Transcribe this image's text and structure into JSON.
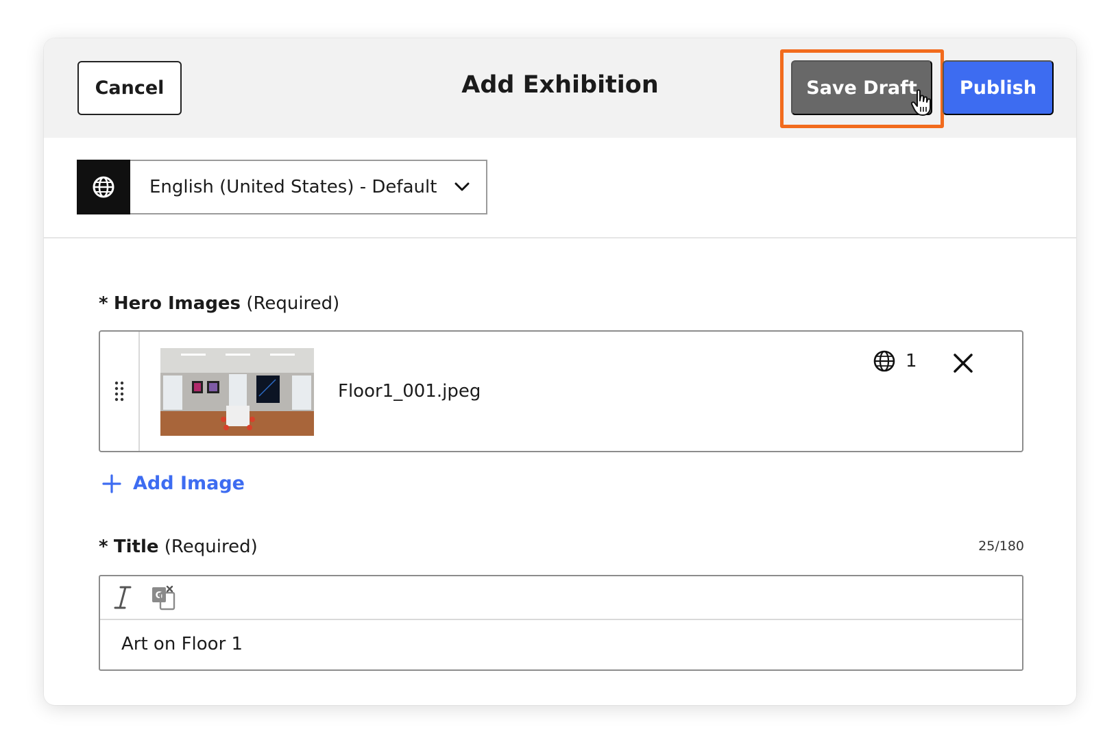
{
  "header": {
    "cancel_label": "Cancel",
    "title": "Add Exhibition",
    "save_draft_label": "Save Draft",
    "publish_label": "Publish"
  },
  "language": {
    "icon": "globe-icon",
    "selected": "English (United States) - Default"
  },
  "hero_images": {
    "label": "Hero Images",
    "required_text": "(Required)",
    "required_marker": "*",
    "items": [
      {
        "filename": "Floor1_001.jpeg",
        "locale_count": "1"
      }
    ],
    "add_label": "Add Image"
  },
  "title_field": {
    "label": "Title",
    "required_text": "(Required)",
    "required_marker": "*",
    "counter": "25/180",
    "value": "Art on Floor 1"
  },
  "colors": {
    "accent": "#3d6cf1",
    "highlight": "#f26b1d",
    "save_draft_bg": "#686868"
  }
}
